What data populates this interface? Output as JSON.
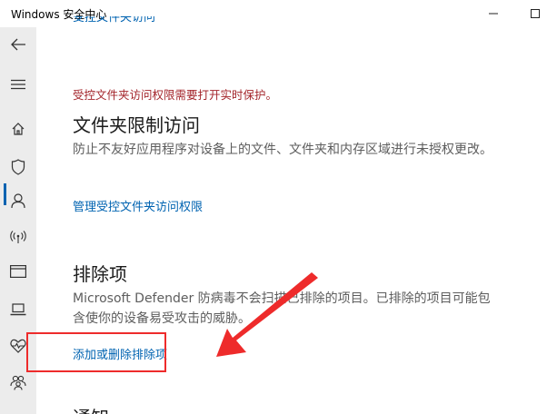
{
  "window": {
    "title": "Windows 安全中心",
    "minimize_icon": "minimize-icon",
    "maximize_icon": "maximize-icon"
  },
  "sidebar": {
    "items": [
      {
        "icon": "back-arrow-icon"
      },
      {
        "icon": "hamburger-menu-icon"
      },
      {
        "icon": "home-icon"
      },
      {
        "icon": "shield-icon",
        "selected": true
      },
      {
        "icon": "person-icon"
      },
      {
        "icon": "wifi-antenna-icon"
      },
      {
        "icon": "app-browser-icon"
      },
      {
        "icon": "laptop-icon"
      },
      {
        "icon": "heart-health-icon"
      },
      {
        "icon": "family-icon"
      }
    ],
    "accent": "#0063b1"
  },
  "content": {
    "top_link_partial": "受控文件夹访问",
    "warning": "受控文件夹访问权限需要打开实时保护。",
    "folder_access": {
      "title": "文件夹限制访问",
      "description": "防止不友好应用程序对设备上的文件、文件夹和内存区域进行未授权更改。",
      "link": "管理受控文件夹访问权限"
    },
    "exclusions": {
      "title": "排除项",
      "description": "Microsoft Defender 防病毒不会扫描已排除的项目。已排除的项目可能包含使你的设备易受攻击的威胁。",
      "link": "添加或删除排除项"
    },
    "next_section_partial": "通知"
  },
  "annotation": {
    "color": "#ee2b2b"
  }
}
